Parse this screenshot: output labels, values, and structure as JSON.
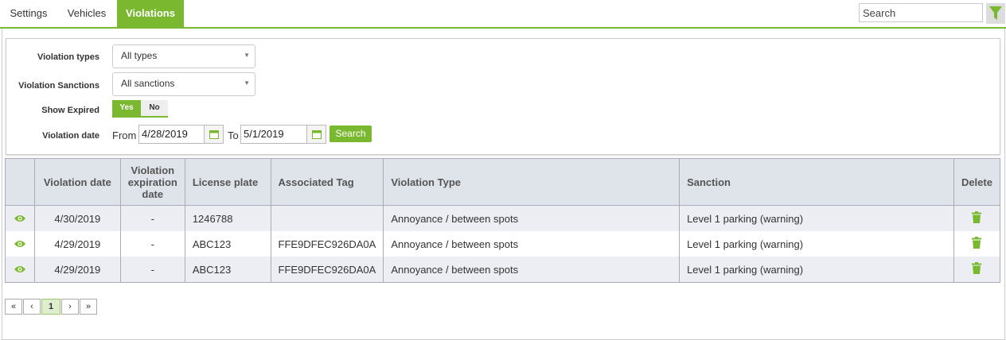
{
  "tabs": [
    {
      "label": "Settings",
      "active": false
    },
    {
      "label": "Vehicles",
      "active": false
    },
    {
      "label": "Violations",
      "active": true
    }
  ],
  "search": {
    "placeholder": "Search",
    "value": ""
  },
  "filter_icon": "filter-icon",
  "filters": {
    "violation_types": {
      "label": "Violation types",
      "value": "All types"
    },
    "violation_sanctions": {
      "label": "Violation Sanctions",
      "value": "All sanctions"
    },
    "show_expired": {
      "label": "Show Expired",
      "yes": "Yes",
      "no": "No",
      "selected": "Yes"
    },
    "violation_date": {
      "label": "Violation date",
      "from_label": "From",
      "from_value": "4/28/2019",
      "to_label": "To",
      "to_value": "5/1/2019"
    },
    "search_button": "Search"
  },
  "table": {
    "headers": [
      "",
      "Violation date",
      "Violation expiration date",
      "License plate",
      "Associated Tag",
      "Violation Type",
      "Sanction",
      "Delete"
    ],
    "rows": [
      {
        "date": "4/30/2019",
        "expiration": "-",
        "plate": "1246788",
        "tag": "",
        "type": "Annoyance / between spots",
        "sanction": "Level 1 parking (warning)"
      },
      {
        "date": "4/29/2019",
        "expiration": "-",
        "plate": "ABC123",
        "tag": "FFE9DFEC926DA0A",
        "type": "Annoyance / between spots",
        "sanction": "Level 1 parking (warning)"
      },
      {
        "date": "4/29/2019",
        "expiration": "-",
        "plate": "ABC123",
        "tag": "FFE9DFEC926DA0A",
        "type": "Annoyance / between spots",
        "sanction": "Level 1 parking (warning)"
      }
    ]
  },
  "pagination": {
    "first": "«",
    "prev": "‹",
    "current": "1",
    "next": "›",
    "last": "»"
  },
  "colors": {
    "accent": "#7ab830",
    "header_bg": "#dfe3ea"
  }
}
